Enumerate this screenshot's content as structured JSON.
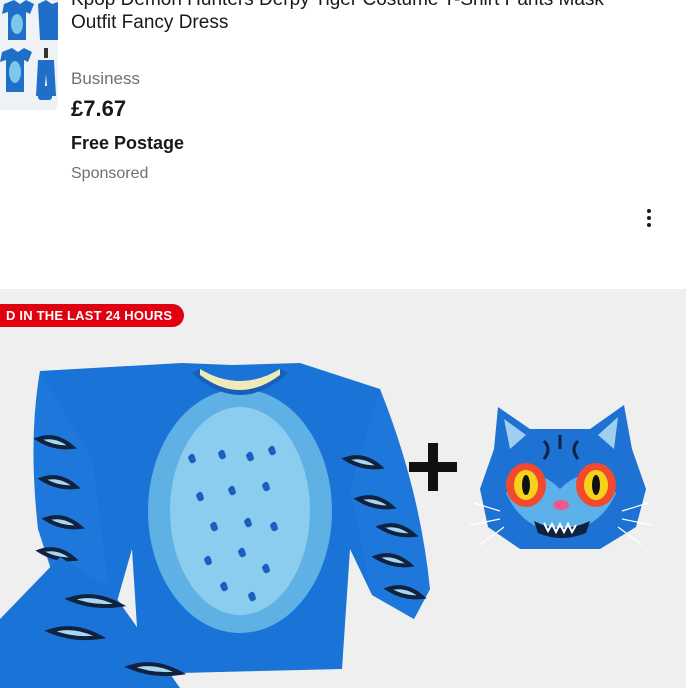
{
  "listing": {
    "title_line1": "Kpop Demon Hunters Derpy Tiger Costume T-Shirt Pants Mask",
    "title_line2": "Outfit Fancy Dress",
    "seller_type": "Business",
    "price": "£7.67",
    "postage": "Free Postage",
    "sponsored": "Sponsored",
    "more_icon": "more-vertical-icon"
  },
  "card": {
    "badge": "D IN THE LAST 24 HOURS",
    "badge_color": "#e0000f",
    "plus_icon": "plus-icon"
  },
  "colors": {
    "costume_blue": "#1a73d6",
    "belly_light_blue": "#7ec6ea",
    "background_grey": "#efefef"
  }
}
